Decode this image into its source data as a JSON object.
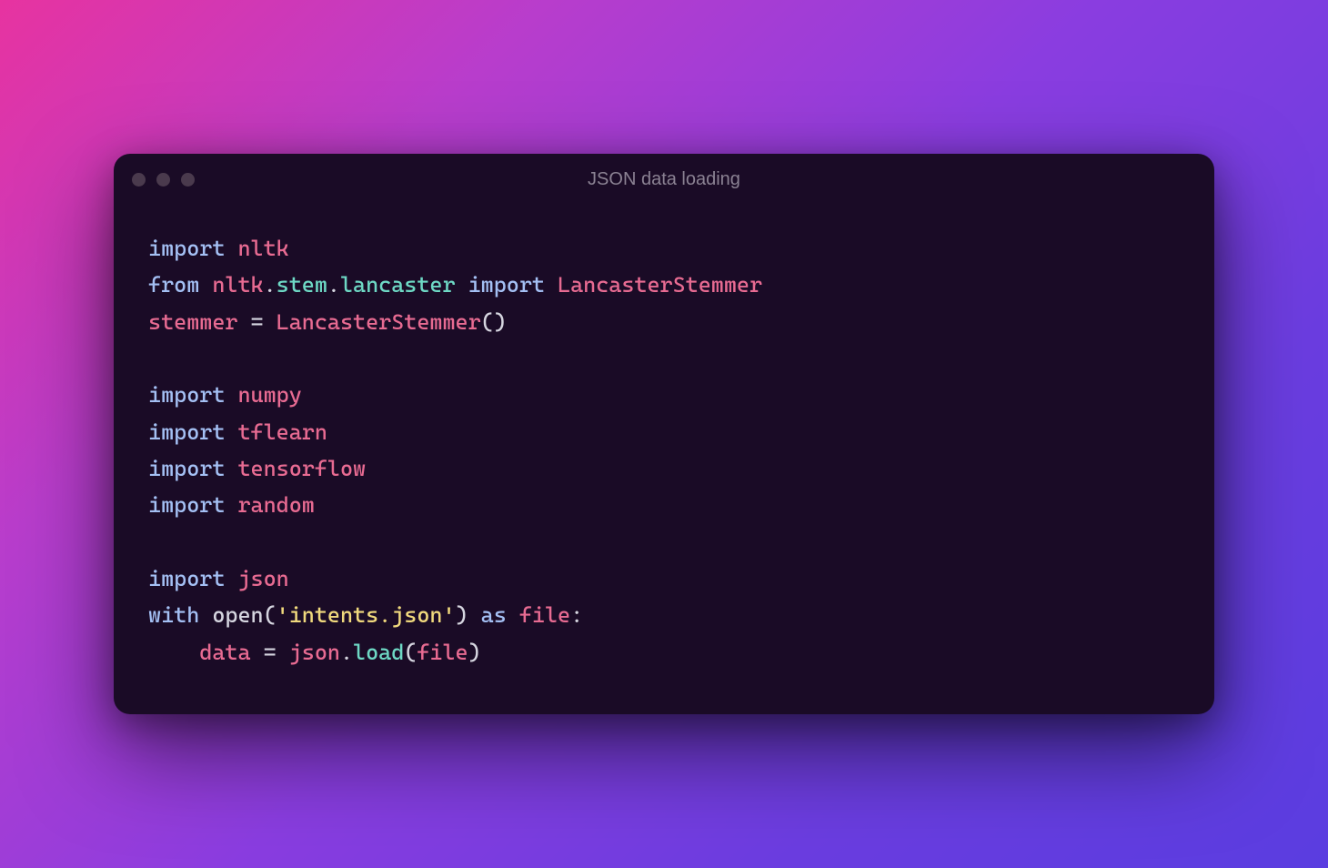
{
  "window": {
    "title": "JSON data loading"
  },
  "code": {
    "l1_kw1": "import",
    "l1_mod": "nltk",
    "l2_kw1": "from",
    "l2_mod1": "nltk",
    "l2_dot1": ".",
    "l2_sub1": "stem",
    "l2_dot2": ".",
    "l2_sub2": "lancaster",
    "l2_kw2": "import",
    "l2_cls": "LancasterStemmer",
    "l3_var": "stemmer",
    "l3_eq": " = ",
    "l3_call": "LancasterStemmer",
    "l3_paren": "()",
    "l4_blank": "",
    "l5_kw": "import",
    "l5_mod": "numpy",
    "l6_kw": "import",
    "l6_mod": "tflearn",
    "l7_kw": "import",
    "l7_mod": "tensorflow",
    "l8_kw": "import",
    "l8_mod": "random",
    "l9_blank": "",
    "l10_kw": "import",
    "l10_mod": "json",
    "l11_kw1": "with",
    "l11_fn": "open",
    "l11_lp": "(",
    "l11_str": "'intents.json'",
    "l11_rp": ")",
    "l11_kw2": "as",
    "l11_var": "file",
    "l11_colon": ":",
    "l12_indent": "    ",
    "l12_var": "data",
    "l12_eq": " = ",
    "l12_mod": "json",
    "l12_dot": ".",
    "l12_fn": "load",
    "l12_lp": "(",
    "l12_arg": "file",
    "l12_rp": ")"
  }
}
